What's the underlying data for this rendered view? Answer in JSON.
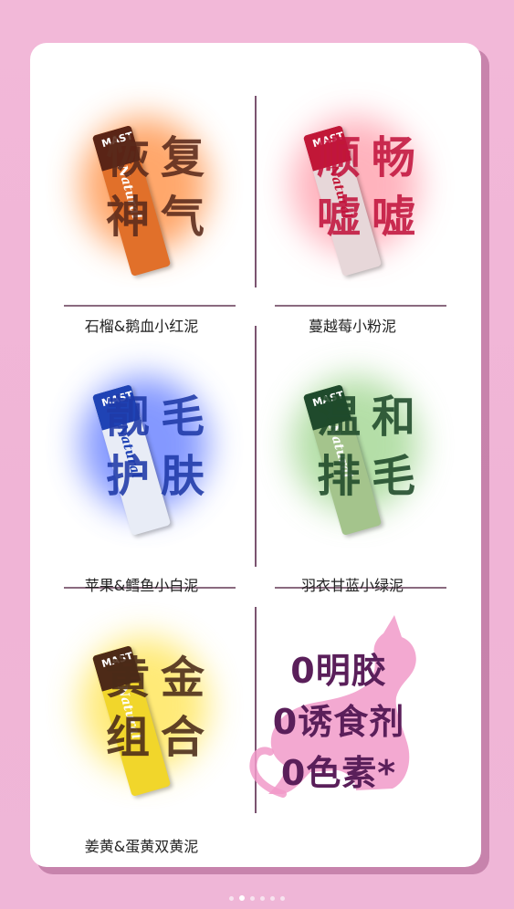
{
  "products": [
    {
      "label": "石榴&鹅血小红泥",
      "big": [
        "恢",
        "复",
        "神",
        "气"
      ],
      "big_color": "#5b2a1b",
      "glow": "#ff8a3a",
      "cap": "#5a2416",
      "body": "#e1702a"
    },
    {
      "label": "蔓越莓小粉泥",
      "big": [
        "顺",
        "畅",
        "嘘",
        "嘘"
      ],
      "big_color": "#c2153e",
      "glow": "#ff9aa8",
      "cap": "#c11737",
      "body": "#e7d7d9"
    },
    {
      "label": "苹果&鳕鱼小白泥",
      "big": [
        "靓",
        "毛",
        "护",
        "肤"
      ],
      "big_color": "#1f3aa8",
      "glow": "#5b76ff",
      "cap": "#1f43b5",
      "body": "#e8ecf6"
    },
    {
      "label": "羽衣甘蓝小绿泥",
      "big": [
        "温",
        "和",
        "排",
        "毛"
      ],
      "big_color": "#1f4a2a",
      "glow": "#9bd48a",
      "cap": "#1f4a2c",
      "body": "#a4c48c"
    },
    {
      "label": "姜黄&蛋黄双黄泥",
      "big": [
        "黄",
        "金",
        "组",
        "合"
      ],
      "big_color": "#4a2a18",
      "glow": "#ffe34a",
      "cap": "#4d2a17",
      "body": "#f1d62b"
    }
  ],
  "stick": {
    "cap_text": "MAST",
    "brand": "Natural"
  },
  "claims": [
    "0明胶",
    "0诱食剂",
    "0色素*"
  ],
  "pagination": {
    "count": 6,
    "active": 1
  }
}
